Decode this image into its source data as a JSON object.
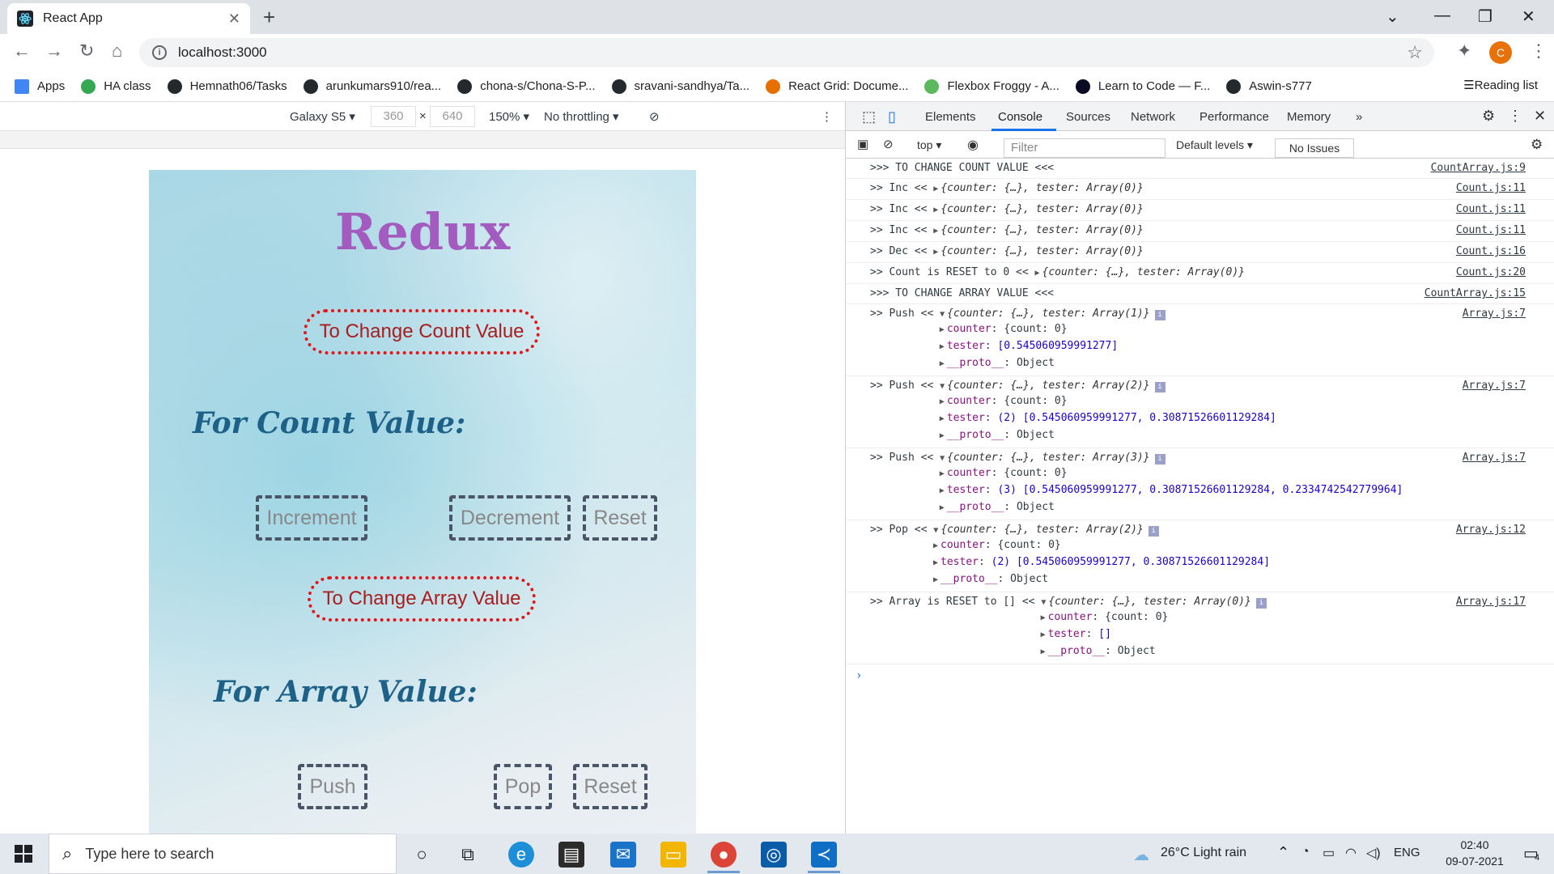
{
  "browser": {
    "tab_title": "React App",
    "url": "localhost:3000",
    "bookmarks": [
      {
        "label": "Apps",
        "color": "#4285f4"
      },
      {
        "label": "HA class",
        "color": "#34a853"
      },
      {
        "label": "Hemnath06/Tasks",
        "color": "#24292e"
      },
      {
        "label": "arunkumars910/rea...",
        "color": "#24292e"
      },
      {
        "label": "chona-s/Chona-S-P...",
        "color": "#24292e"
      },
      {
        "label": "sravani-sandhya/Ta...",
        "color": "#24292e"
      },
      {
        "label": "React Grid: Docume...",
        "color": "#e76f00"
      },
      {
        "label": "Flexbox Froggy - A...",
        "color": "#5cb85c"
      },
      {
        "label": "Learn to Code — F...",
        "color": "#0a0a23"
      },
      {
        "label": "Aswin-s777",
        "color": "#24292e"
      }
    ],
    "reading_list": "Reading list",
    "profile_initial": "C"
  },
  "device_toolbar": {
    "device": "Galaxy S5",
    "width": "360",
    "height": "640",
    "zoom": "150%",
    "throttling": "No throttling"
  },
  "page": {
    "title": "Redux",
    "change_count_btn": "To Change Count Value",
    "count_heading": "For Count Value:",
    "increment_btn": "Increment",
    "decrement_btn": "Decrement",
    "reset_count_btn": "Reset",
    "change_array_btn": "To Change Array Value",
    "array_heading": "For Array Value:",
    "push_btn": "Push",
    "pop_btn": "Pop",
    "reset_array_btn": "Reset"
  },
  "devtools": {
    "tabs": [
      "Elements",
      "Console",
      "Sources",
      "Network",
      "Performance",
      "Memory"
    ],
    "context": "top",
    "filter_placeholder": "Filter",
    "levels": "Default levels",
    "issues": "No Issues"
  },
  "console": {
    "simple_rows": [
      {
        "text": ">>> TO CHANGE COUNT VALUE <<<",
        "obj": "",
        "src": "CountArray.js:9"
      },
      {
        "text": ">> Inc << ",
        "obj": "{counter: {…}, tester: Array(0)}",
        "src": "Count.js:11"
      },
      {
        "text": ">> Inc << ",
        "obj": "{counter: {…}, tester: Array(0)}",
        "src": "Count.js:11"
      },
      {
        "text": ">> Inc << ",
        "obj": "{counter: {…}, tester: Array(0)}",
        "src": "Count.js:11"
      },
      {
        "text": ">> Dec << ",
        "obj": "{counter: {…}, tester: Array(0)}",
        "src": "Count.js:16"
      },
      {
        "text": ">> Count is RESET to 0 << ",
        "obj": "{counter: {…}, tester: Array(0)}",
        "src": "Count.js:20"
      },
      {
        "text": ">>> TO CHANGE ARRAY VALUE <<<",
        "obj": "",
        "src": "CountArray.js:15"
      }
    ],
    "expanded_rows": [
      {
        "text": ">> Push << ",
        "obj": "{counter: {…}, tester: Array(1)}",
        "src": "Array.js:7",
        "counter": "{count: 0}",
        "tester": "[0.545060959991277]",
        "proto": "Object"
      },
      {
        "text": ">> Push << ",
        "obj": "{counter: {…}, tester: Array(2)}",
        "src": "Array.js:7",
        "counter": "{count: 0}",
        "tester": "(2) [0.545060959991277, 0.30871526601129284]",
        "proto": "Object"
      },
      {
        "text": ">> Push << ",
        "obj": "{counter: {…}, tester: Array(3)}",
        "src": "Array.js:7",
        "counter": "{count: 0}",
        "tester": "(3) [0.545060959991277, 0.30871526601129284, 0.2334742542779964]",
        "proto": "Object"
      },
      {
        "text": ">> Pop << ",
        "obj": "{counter: {…}, tester: Array(2)}",
        "src": "Array.js:12",
        "counter": "{count: 0}",
        "tester": "(2) [0.545060959991277, 0.30871526601129284]",
        "proto": "Object"
      },
      {
        "text": ">> Array is RESET to [] << ",
        "obj": "{counter: {…}, tester: Array(0)}",
        "src": "Array.js:17",
        "counter": "{count: 0}",
        "tester": "[]",
        "proto": "Object"
      }
    ],
    "labels": {
      "counter": "counter",
      "tester": "tester",
      "proto": "__proto__"
    }
  },
  "taskbar": {
    "search_placeholder": "Type here to search",
    "weather": "26°C  Light rain",
    "language": "ENG",
    "time": "02:40",
    "date": "09-07-2021",
    "notifications": "4"
  }
}
